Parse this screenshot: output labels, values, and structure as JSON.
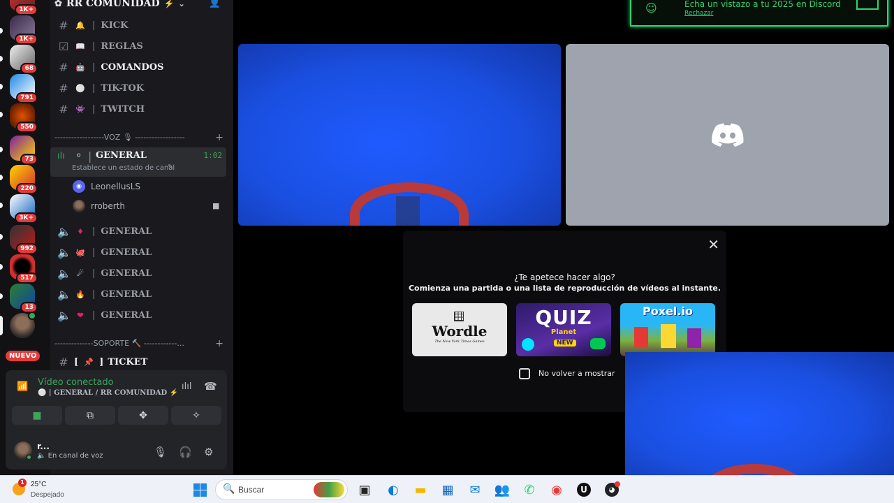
{
  "server_bar": {
    "servers": [
      {
        "name": "server-1",
        "badge": "1K+"
      },
      {
        "name": "server-2",
        "badge": "1K+"
      },
      {
        "name": "server-3",
        "badge": "68"
      },
      {
        "name": "server-4",
        "badge": "791"
      },
      {
        "name": "server-5",
        "badge": "550"
      },
      {
        "name": "server-6",
        "badge": "73"
      },
      {
        "name": "server-7",
        "badge": "220"
      },
      {
        "name": "server-8",
        "badge": "3K+"
      },
      {
        "name": "server-9",
        "badge": "992"
      },
      {
        "name": "server-10",
        "badge": "517"
      },
      {
        "name": "server-11",
        "badge": "13"
      },
      {
        "name": "server-12",
        "badge": ""
      }
    ],
    "new_pill": "NUEVO"
  },
  "server": {
    "name": "RR COMUNIDAD"
  },
  "channels": {
    "text": [
      {
        "name": "KICK",
        "icon": "bell-icon"
      },
      {
        "name": "REGLAS",
        "icon": "book-icon"
      },
      {
        "name": "COMANDOS",
        "icon": "robot-icon"
      },
      {
        "name": "TIK-TOK",
        "icon": "circle-icon"
      },
      {
        "name": "TWITCH",
        "icon": "invader-icon"
      }
    ],
    "voice_category": "------------------VOZ 🎙 ------------------",
    "active_voice": {
      "name": "GENERAL",
      "time": "1:02",
      "status": "Establece un estado de canal"
    },
    "members": [
      {
        "name": "LeonellusLS"
      },
      {
        "name": "rroberth"
      }
    ],
    "other_voice": [
      "GENERAL",
      "GENERAL",
      "GENERAL",
      "GENERAL",
      "GENERAL"
    ],
    "support_category": "--------------SOPORTE 🔨 ------------...",
    "ticket": "TICKET"
  },
  "voice_panel": {
    "title": "Vídeo conectado",
    "subtitle": "GENERAL / RR COMUNIDAD",
    "user_name": "r...",
    "user_status": "En canal de voz"
  },
  "notice": {
    "text": "Echa un vistazo a tu 2025 en Discord",
    "dismiss": "Rechazar"
  },
  "activity": {
    "question": "¿Te apetece hacer algo?",
    "prompt": "Comienza una partida o una lista de reproducción de vídeos al instante.",
    "cards": [
      {
        "title": "Wordle",
        "sub": "The New York Times Games"
      },
      {
        "title": "QUIZ",
        "sub": "Planet",
        "tag": "NEW"
      },
      {
        "title": "Poxel.io"
      }
    ],
    "checkbox_label": "No volver a mostrar"
  },
  "taskbar": {
    "temperature": "25°C",
    "weather": "Despejado",
    "weather_badge": "1",
    "search_placeholder": "Buscar"
  },
  "colors": {
    "accent_green": "#2ed573",
    "online": "#3ba55d",
    "badge": "#e23b3b",
    "discord_blue": "#5865f2"
  }
}
